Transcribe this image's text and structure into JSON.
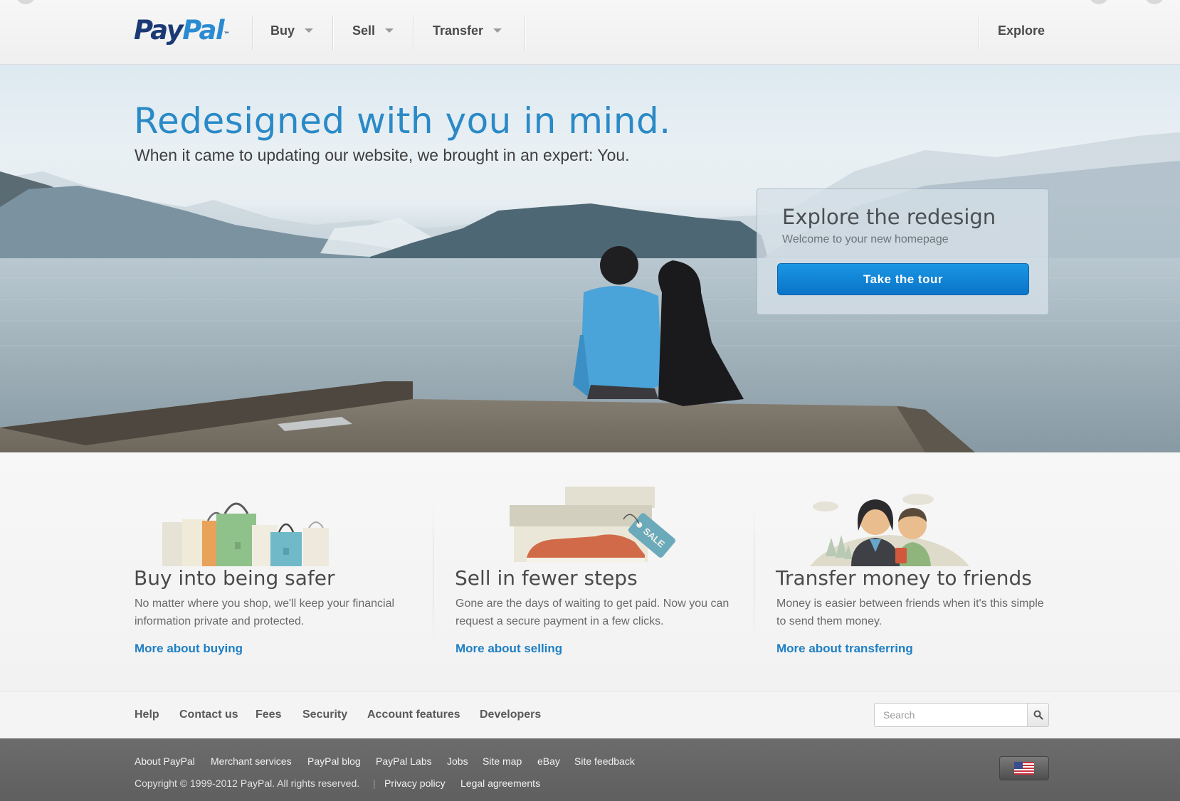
{
  "header": {
    "logo": {
      "pay": "Pay",
      "pal": "Pal",
      "tm": "™"
    },
    "nav": [
      {
        "label": "Buy"
      },
      {
        "label": "Sell"
      },
      {
        "label": "Transfer"
      }
    ],
    "explore_label": "Explore"
  },
  "hero": {
    "title": "Redesigned with you in mind.",
    "subtitle": "When it came to updating our website, we brought in an expert: You.",
    "promo": {
      "title": "Explore the redesign",
      "subtitle": "Welcome to your new homepage",
      "button_label": "Take the tour"
    },
    "sale_tag": "SALE"
  },
  "features": [
    {
      "title": "Buy into being safer",
      "description": "No matter where you shop, we'll keep your financial information private and protected.",
      "link": "More about buying",
      "icon": "shopping-bags-icon"
    },
    {
      "title": "Sell in fewer steps",
      "description": "Gone are the days of waiting to get paid. Now you can request a secure payment in a few clicks.",
      "link": "More about selling",
      "icon": "shoe-box-icon"
    },
    {
      "title": "Transfer money to friends",
      "description": "Money is easier between friends when it's this simple to send them money.",
      "link": "More about transferring",
      "icon": "friends-icon"
    }
  ],
  "footer": {
    "links": [
      "Help",
      "Contact us",
      "Fees",
      "Security",
      "Account features",
      "Developers"
    ],
    "search": {
      "placeholder": "Search",
      "value": "",
      "icon": "search-icon"
    }
  },
  "bottom": {
    "links": [
      "About PayPal",
      "Merchant services",
      "PayPal blog",
      "PayPal Labs",
      "Jobs",
      "Site map",
      "eBay",
      "Site feedback"
    ],
    "copyright": "Copyright © 1999-2012 PayPal. All rights reserved.",
    "separator": "|",
    "legal_links": [
      "Privacy policy",
      "Legal agreements"
    ],
    "flag_icon": "us-flag-icon"
  },
  "colors": {
    "brand_dark": "#1b3a75",
    "brand_light": "#2a8bd2",
    "link": "#1e7fc4",
    "button": "#0a74c8"
  }
}
